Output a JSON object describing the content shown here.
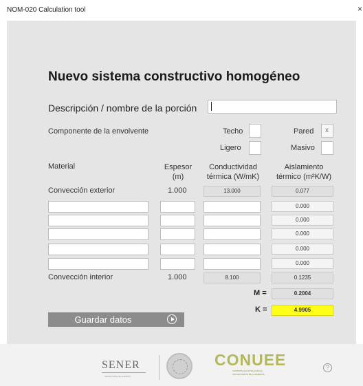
{
  "window": {
    "title": "NOM-020 Calculation tool",
    "close_glyph": "×"
  },
  "heading": "Nuevo sistema constructivo homogéneo",
  "description": {
    "label": "Descripción / nombre de la porción",
    "value": ""
  },
  "envelope": {
    "label": "Componente de la envolvente",
    "techo": "Techo",
    "pared": "Pared",
    "pared_mark": "x",
    "ligero": "Ligero",
    "masivo": "Masivo"
  },
  "columns": {
    "material": "Material",
    "espesor": "Espesor",
    "espesor_unit": "(m)",
    "conductividad": "Conductividad",
    "conductividad_unit": "térmica (W/mK)",
    "aislamiento": "Aislamiento",
    "aislamiento_unit": "térmico (m²K/W)"
  },
  "exterior": {
    "label": "Convección exterior",
    "espesor": "1.000",
    "conductividad": "13.000",
    "aislamiento": "0.077"
  },
  "layers": [
    {
      "aislamiento": "0.000"
    },
    {
      "aislamiento": "0.000"
    },
    {
      "aislamiento": "0.000"
    },
    {
      "aislamiento": "0.000"
    },
    {
      "aislamiento": "0.000"
    }
  ],
  "interior": {
    "label": "Convección interior",
    "espesor": "1.000",
    "conductividad": "8.100",
    "aislamiento": "0.1235"
  },
  "results": {
    "m_label": "M =",
    "m_value": "0.2004",
    "k_label": "K =",
    "k_value": "4.9905",
    "k_color": "#ffff1a"
  },
  "save_button": "Guardar datos",
  "footer": {
    "sener": "SENER",
    "sener_sub": "SECRETARÍA DE ENERGÍA",
    "conuee": "CONUEE",
    "conuee_sub1": "COMISIÓN NACIONAL PARA EL",
    "conuee_sub2": "USO EFICIENTE DE LA ENERGÍA",
    "help": "?"
  },
  "icons": [
    "play-circle-icon",
    "help-icon",
    "close-icon",
    "seal-icon"
  ]
}
